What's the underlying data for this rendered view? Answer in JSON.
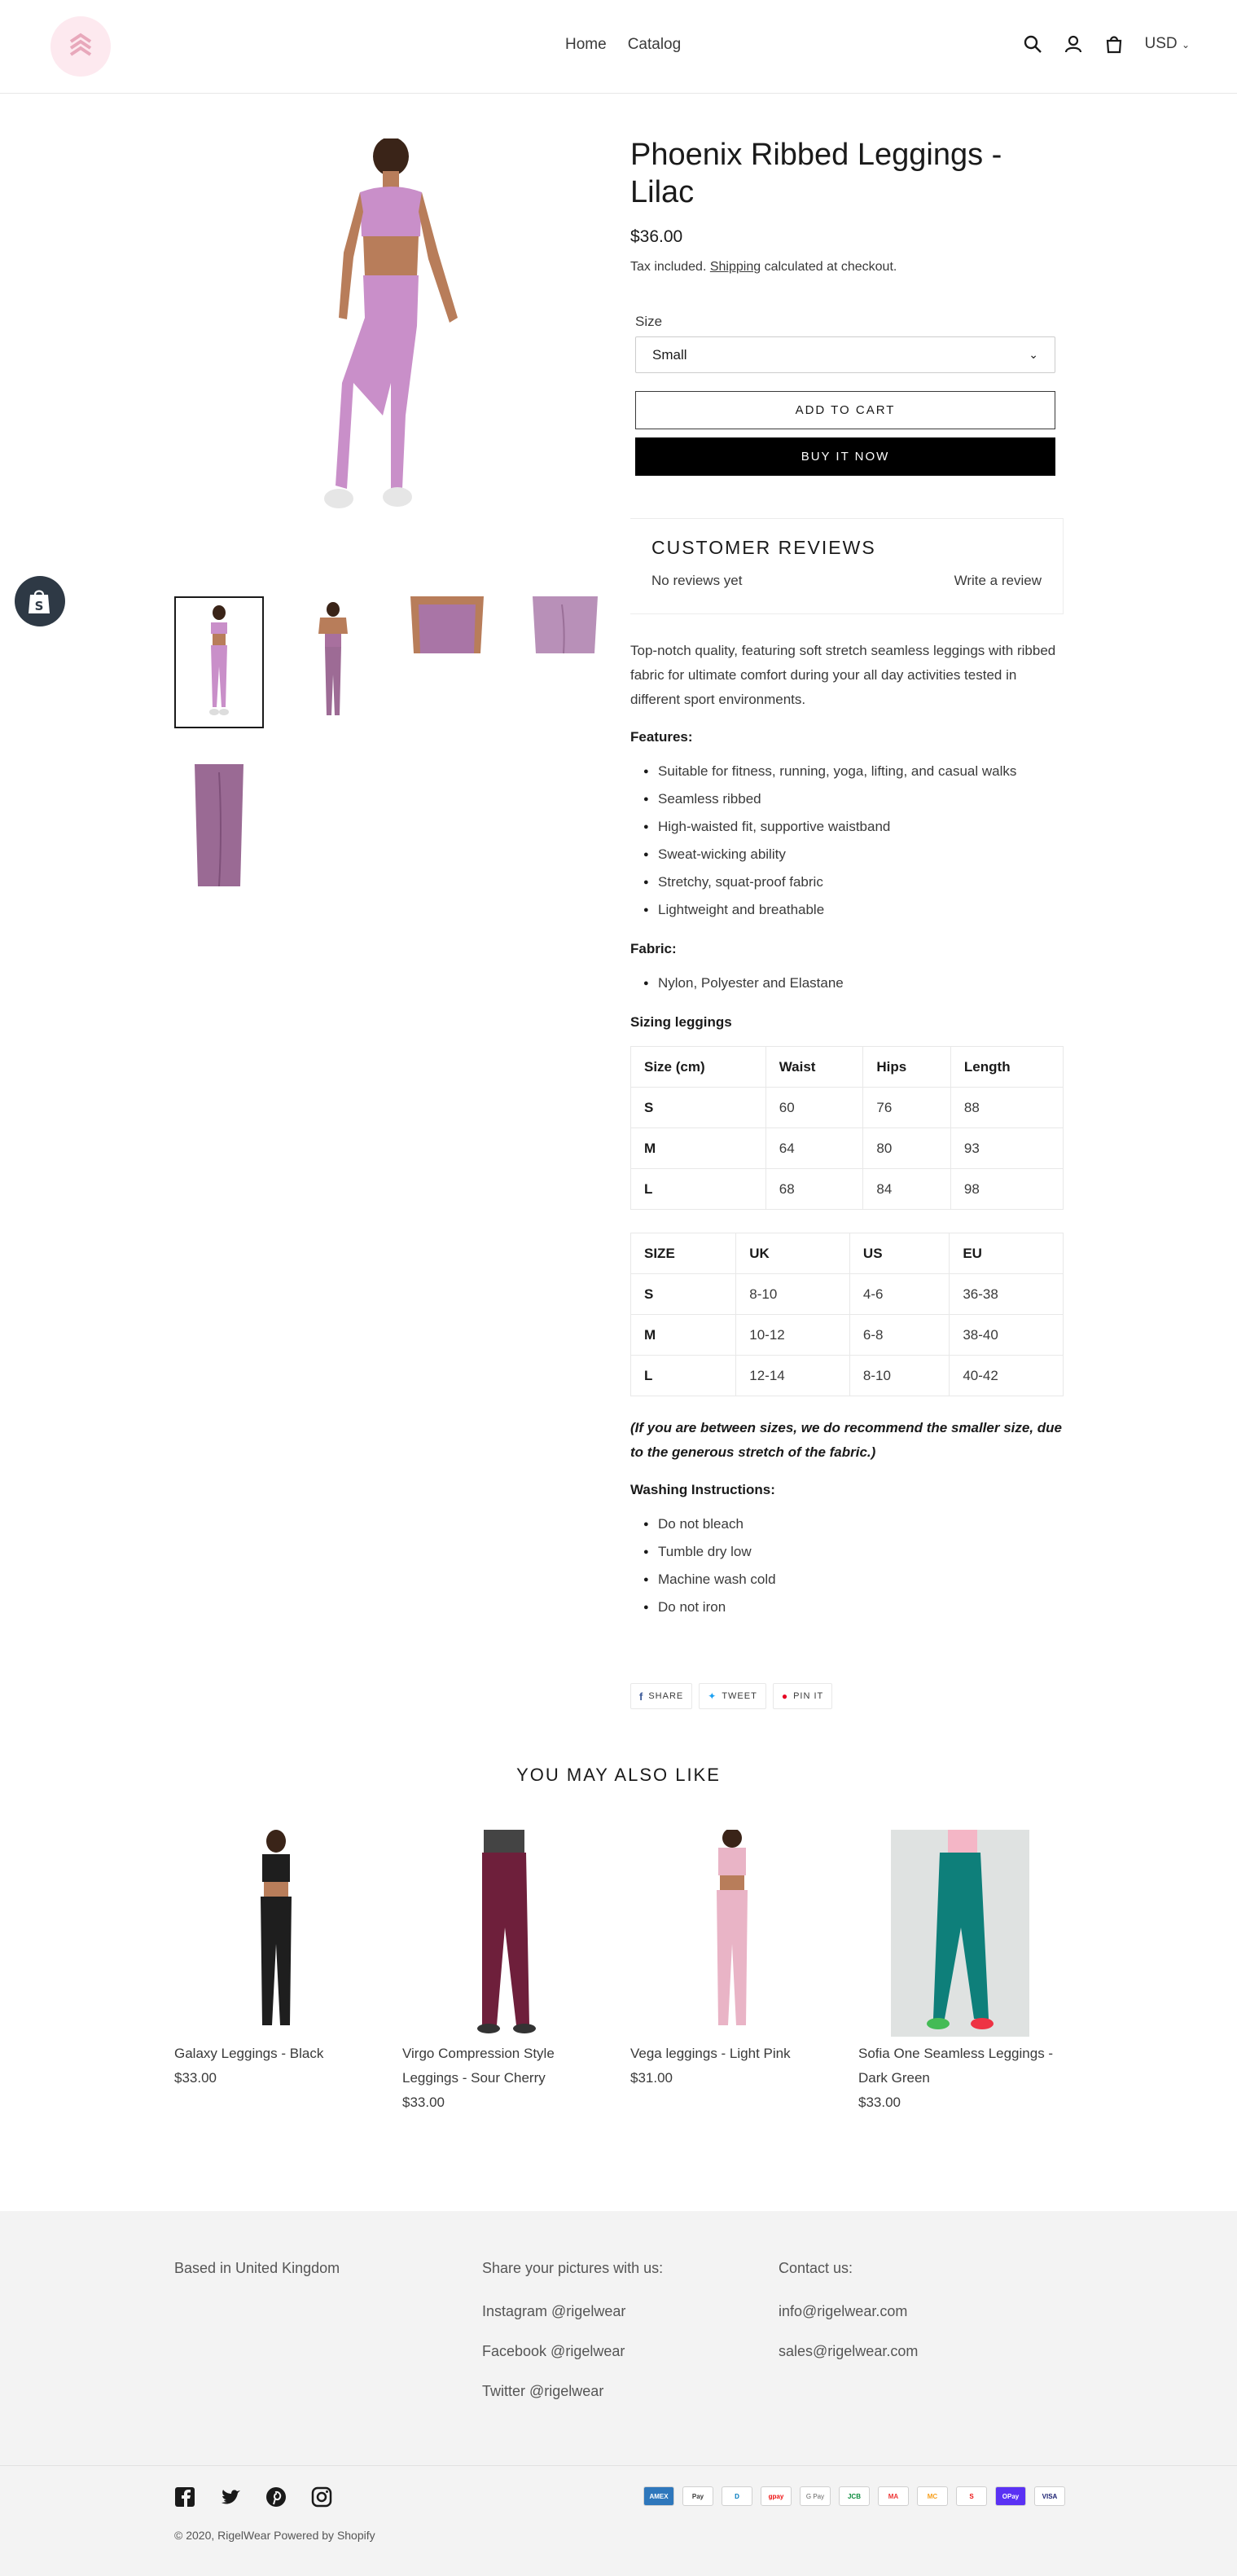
{
  "header": {
    "nav": [
      "Home",
      "Catalog"
    ],
    "currency": "USD"
  },
  "product": {
    "title": "Phoenix Ribbed Leggings - Lilac",
    "price": "$36.00",
    "tax_prefix": "Tax included.",
    "tax_link": "Shipping",
    "tax_suffix": "calculated at checkout.",
    "size_label": "Size",
    "size_value": "Small",
    "add_to_cart": "ADD TO CART",
    "buy_now": "BUY IT NOW"
  },
  "reviews": {
    "title": "CUSTOMER REVIEWS",
    "no_reviews": "No reviews yet",
    "write": "Write a review"
  },
  "description": {
    "intro": "Top-notch quality, featuring soft stretch seamless leggings with ribbed fabric for ultimate comfort during your all day activities tested in different sport environments.",
    "features_title": "Features:",
    "features": [
      "Suitable for fitness, running, yoga, lifting, and casual walks",
      "Seamless ribbed",
      "High-waisted fit, supportive waistband",
      "Sweat-wicking ability",
      "Stretchy, squat-proof fabric",
      "Lightweight and breathable"
    ],
    "fabric_title": "Fabric:",
    "fabric": [
      "Nylon, Polyester and Elastane"
    ],
    "sizing_title": "Sizing leggings",
    "table1": [
      [
        "Size (cm)",
        "Waist",
        "Hips",
        "Length"
      ],
      [
        "S",
        "60",
        "76",
        "88"
      ],
      [
        "M",
        "64",
        "80",
        "93"
      ],
      [
        "L",
        "68",
        "84",
        "98"
      ]
    ],
    "table2": [
      [
        "SIZE",
        "UK",
        "US",
        "EU"
      ],
      [
        "S",
        "8-10",
        "4-6",
        "36-38"
      ],
      [
        "M",
        "10-12",
        "6-8",
        "38-40"
      ],
      [
        "L",
        "12-14",
        "8-10",
        "40-42"
      ]
    ],
    "note": "(If you are between sizes, we do recommend the smaller size, due to the generous stretch of the fabric.)",
    "washing_title": "Washing Instructions:",
    "washing": [
      "Do not bleach",
      "Tumble dry low",
      "Machine wash cold",
      "Do not iron"
    ]
  },
  "share": {
    "share": "SHARE",
    "tweet": "TWEET",
    "pin": "PIN IT"
  },
  "related": {
    "title": "YOU MAY ALSO LIKE",
    "items": [
      {
        "name": "Galaxy Leggings - Black",
        "price": "$33.00",
        "color": "#1e1e1e"
      },
      {
        "name": "Virgo Compression Style Leggings - Sour Cherry",
        "price": "$33.00",
        "color": "#6e1f3b"
      },
      {
        "name": "Vega leggings - Light Pink",
        "price": "$31.00",
        "color": "#e9b4c6"
      },
      {
        "name": "Sofia One Seamless Leggings - Dark Green",
        "price": "$33.00",
        "color": "#0e7f7a"
      }
    ]
  },
  "footer": {
    "col1": [
      "Based in United Kingdom"
    ],
    "col2_title": "Share your pictures with us:",
    "col2": [
      "Instagram @rigelwear",
      "Facebook @rigelwear",
      "Twitter @rigelwear"
    ],
    "col3_title": "Contact us:",
    "col3": [
      "info@rigelwear.com",
      "sales@rigelwear.com"
    ],
    "copyright": "© 2020, RigelWear Powered by Shopify",
    "payments": [
      "AMEX",
      "Pay",
      "D",
      "gpay",
      "G Pay",
      "JCB",
      "MA",
      "MC",
      "S",
      "OPay",
      "VISA"
    ]
  },
  "colors": {
    "lilac": "#c98fc9",
    "accent_black": "#000000"
  }
}
